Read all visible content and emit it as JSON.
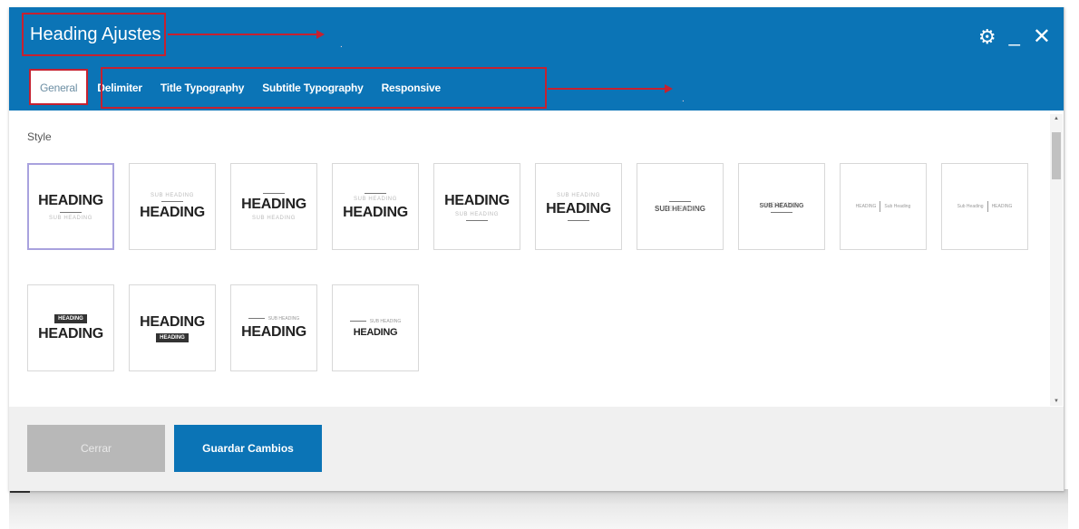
{
  "dialog": {
    "title": "Heading Ajustes",
    "header_icons": [
      "gear-icon",
      "minimize-icon",
      "close-icon"
    ]
  },
  "tabs": [
    {
      "label": "General",
      "active": true
    },
    {
      "label": "Delimiter",
      "active": false
    },
    {
      "label": "Title Typography",
      "active": false
    },
    {
      "label": "Subtitle Typography",
      "active": false
    },
    {
      "label": "Responsive",
      "active": false
    }
  ],
  "content": {
    "section_label": "Style",
    "styles": [
      {
        "main": "HEADING",
        "sub": "SUB HEADING",
        "selected": true
      },
      {
        "main": "HEADING",
        "sub": "SUB HEADING"
      },
      {
        "main": "HEADING",
        "sub": "SUB HEADING"
      },
      {
        "main": "HEADING",
        "sub": "SUB HEADING"
      },
      {
        "main": "HEADING",
        "sub": "SUB HEADING"
      },
      {
        "main": "HEADING",
        "sub": "SUB HEADING"
      },
      {
        "main": "HEADING",
        "sub": "SUB HEADING"
      },
      {
        "main": "HEADING",
        "sub": "SUB HEADING"
      },
      {
        "main": "HEADING",
        "sub": "Sub Heading"
      },
      {
        "main": "HEADING",
        "sub": "Sub Heading"
      },
      {
        "main": "HEADING",
        "sub": "HEADING"
      },
      {
        "main": "HEADING",
        "sub": "HEADING"
      },
      {
        "main": "HEADING",
        "sub": "SUB HEADING"
      },
      {
        "main": "HEADING",
        "sub": "SUB HEADING"
      }
    ]
  },
  "footer": {
    "cancel_label": "Cerrar",
    "save_label": "Guardar Cambios"
  },
  "colors": {
    "header": "#0b74b6",
    "annotation": "#c62130",
    "selected_border": "#a9a2de"
  }
}
